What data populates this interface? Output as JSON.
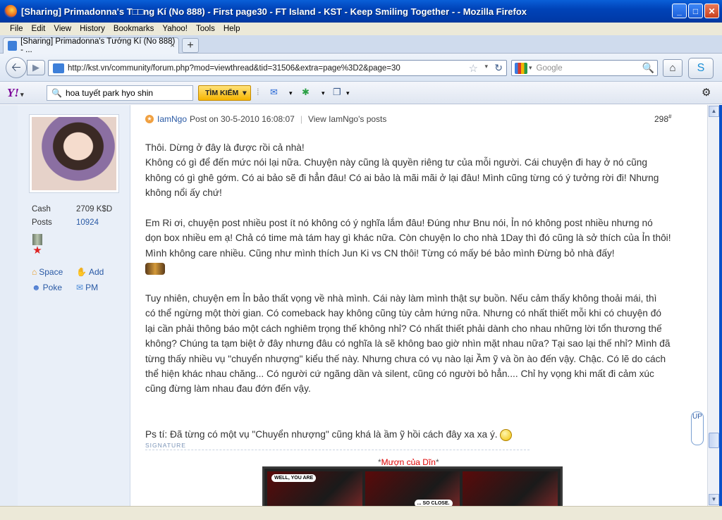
{
  "window": {
    "title": "[Sharing] Primadonna's T□□ng Kí (No 888) - First page30 - FT Island - KST - Keep Smiling Together - - Mozilla Firefox",
    "min_label": "_",
    "max_label": "□",
    "close_label": "✕"
  },
  "menu": {
    "items": [
      "File",
      "Edit",
      "View",
      "History",
      "Bookmarks",
      "Yahoo!",
      "Tools",
      "Help"
    ]
  },
  "tab": {
    "title": "[Sharing] Primadonna's Tướng Kí (No 888) - ...",
    "close": "×",
    "new": "+"
  },
  "nav": {
    "back": "🡠",
    "forward": "▶",
    "url": "http://kst.vn/community/forum.php?mod=viewthread&tid=31506&extra=page%3D2&page=30",
    "star": "☆",
    "dd": "▾",
    "reload": "↻",
    "search_placeholder": "Google",
    "search_icon": "🔍",
    "home": "⌂",
    "skype": "S"
  },
  "yahoo": {
    "logo": "Y!",
    "logo_dd": "▾",
    "query": "hoa tuyết park hyo shin",
    "button": "TÌM KIẾM",
    "button_dd": "▾",
    "gear": "⚙"
  },
  "profile": {
    "cash_label": "Cash",
    "cash_value": "2709 K$D",
    "posts_label": "Posts",
    "posts_value": "10924",
    "space": "Space",
    "add": "Add",
    "poke": "Poke",
    "pm": "PM"
  },
  "post": {
    "author": "IamNgo",
    "meta": "Post on 30-5-2010 16:08:07",
    "view_link": "View IamNgo's posts",
    "number": "298",
    "number_sup": "#",
    "p1_l1": "Thôi. Dừng ở đây là được rồi cả nhà!",
    "p1_l2": "Không có gì để đến mức nói lại nữa. Chuyện này cũng là quyền riêng tư của mỗi người. Cái chuyện đi hay ở nó cũng",
    "p1_l3": "không có gì ghê gớm. Có ai bảo sẽ đi hẳn đâu! Có ai bảo là mãi mãi ở lại đâu! Mình cũng từng có ý tưởng rời đi! Nhưng",
    "p1_l4": "không nổi ấy chứ!",
    "p2_l1": "Em Ri ơi, chuyện post nhiều post ít nó không có ý nghĩa lắm đâu! Đúng như Bnu nói, Ỉn nó không post nhiều nhưng nó",
    "p2_l2": "dọn box nhiều em ạ! Chả có time mà tám hay gì khác nữa. Còn chuyện lo cho nhà 1Day thì đó cũng là sở thích của Ỉn thôi!",
    "p2_l3": "Mình không care nhiều. Cũng như mình thích Jun Ki vs CN thôi! Từng có mấy bé bảo mình Đừng bỏ nhà đấy!",
    "p3_l1": "Tuy nhiên, chuyện em Ỉn bảo thất vọng về nhà mình. Cái này làm mình thật sự buồn. Nếu cảm thấy không thoải mái, thì",
    "p3_l2": "có thể ngừng một thời gian. Có comeback hay không cũng tùy cảm hứng nữa. Nhưng có nhất thiết mỗi khi có chuyện đó",
    "p3_l3": "lại cần phải thông báo một cách nghiêm trọng thế không nhỉ? Có nhất thiết phải dành cho nhau những lời tổn thương thế",
    "p3_l4": "không? Chúng ta tạm biệt ở đây nhưng đâu có nghĩa là sẽ không bao giờ nhìn mặt nhau nữa? Tại sao lại thế nhỉ? Mình đã",
    "p3_l5": "từng thấy nhiều vụ \"chuyển nhượng\" kiểu thế này. Nhưng chưa có vụ nào lại Ầm ỹ và ồn ào đến vậy. Chậc. Có lẽ do cách",
    "p3_l6": "thể hiện khác nhau chăng... Có người cứ ngãng dần và silent, cũng có người bỏ hẳn.... Chỉ hy vọng khi mất đi cảm xúc",
    "p3_l7": "cũng đừng làm nhau đau đớn đến vậy.",
    "ps": "Ps tí: Đã từng có một vụ \"Chuyển nhượng\" cũng khá là ầm ỹ hồi cách đây xa xa ý.",
    "signature_label": "SIGNATURE",
    "sig_star": "*",
    "sig_title": "Mượn của Dĩn",
    "sig_bubble1": "WELL, YOU ARE",
    "sig_bubble2": "... SO CLOSE."
  },
  "float_button": "UP",
  "scroll": {
    "up": "▲",
    "down": "▼"
  }
}
